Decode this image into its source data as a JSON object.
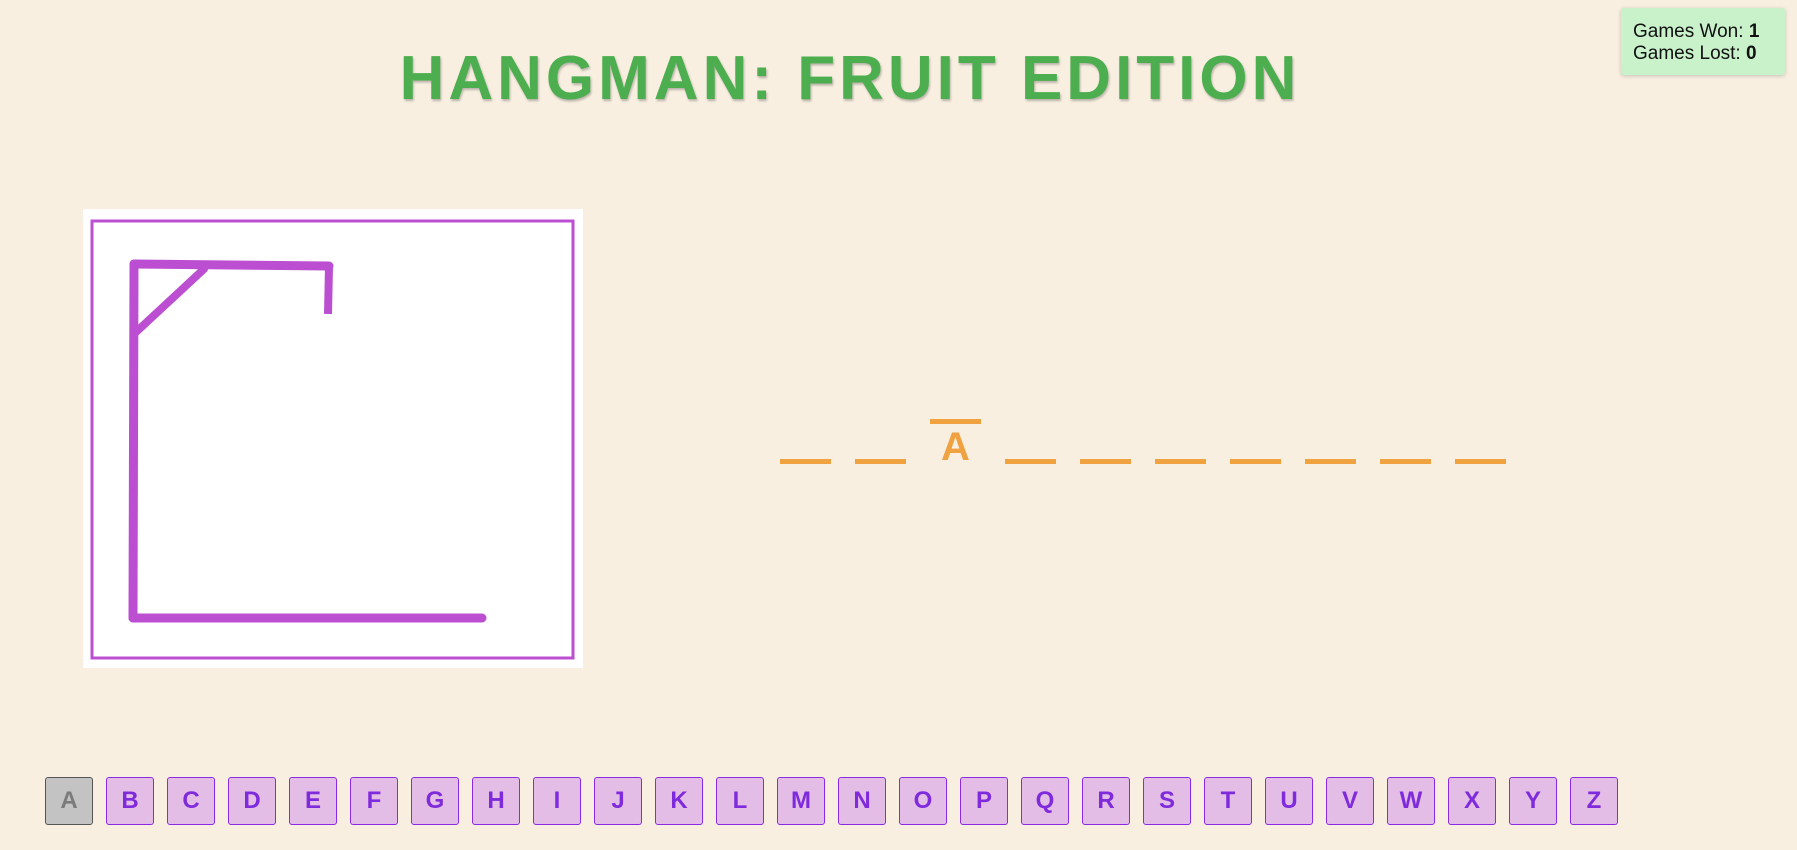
{
  "header": {
    "title": "HANGMAN: FRUIT EDITION"
  },
  "score": {
    "won_label": "Games Won:",
    "won_value": "1",
    "lost_label": "Games Lost:",
    "lost_value": "0"
  },
  "drawing": {
    "stage_parts_drawn": [
      "base",
      "pole",
      "beam",
      "brace",
      "rope"
    ],
    "stroke_color": "#bc4fd1"
  },
  "word": {
    "slots": [
      "",
      "",
      "A",
      "",
      "",
      "",
      "",
      "",
      "",
      ""
    ]
  },
  "keyboard": {
    "keys": [
      {
        "letter": "A",
        "used": true
      },
      {
        "letter": "B",
        "used": false
      },
      {
        "letter": "C",
        "used": false
      },
      {
        "letter": "D",
        "used": false
      },
      {
        "letter": "E",
        "used": false
      },
      {
        "letter": "F",
        "used": false
      },
      {
        "letter": "G",
        "used": false
      },
      {
        "letter": "H",
        "used": false
      },
      {
        "letter": "I",
        "used": false
      },
      {
        "letter": "J",
        "used": false
      },
      {
        "letter": "K",
        "used": false
      },
      {
        "letter": "L",
        "used": false
      },
      {
        "letter": "M",
        "used": false
      },
      {
        "letter": "N",
        "used": false
      },
      {
        "letter": "O",
        "used": false
      },
      {
        "letter": "P",
        "used": false
      },
      {
        "letter": "Q",
        "used": false
      },
      {
        "letter": "R",
        "used": false
      },
      {
        "letter": "S",
        "used": false
      },
      {
        "letter": "T",
        "used": false
      },
      {
        "letter": "U",
        "used": false
      },
      {
        "letter": "V",
        "used": false
      },
      {
        "letter": "W",
        "used": false
      },
      {
        "letter": "X",
        "used": false
      },
      {
        "letter": "Y",
        "used": false
      },
      {
        "letter": "Z",
        "used": false
      }
    ]
  },
  "colors": {
    "background": "#f8efe1",
    "title": "#4cae4f",
    "word": "#f0a241",
    "key_bg": "#e3bde6",
    "key_text": "#7f2bdc",
    "key_used_bg": "#c3c3c3",
    "score_bg": "#c9f2cb"
  }
}
